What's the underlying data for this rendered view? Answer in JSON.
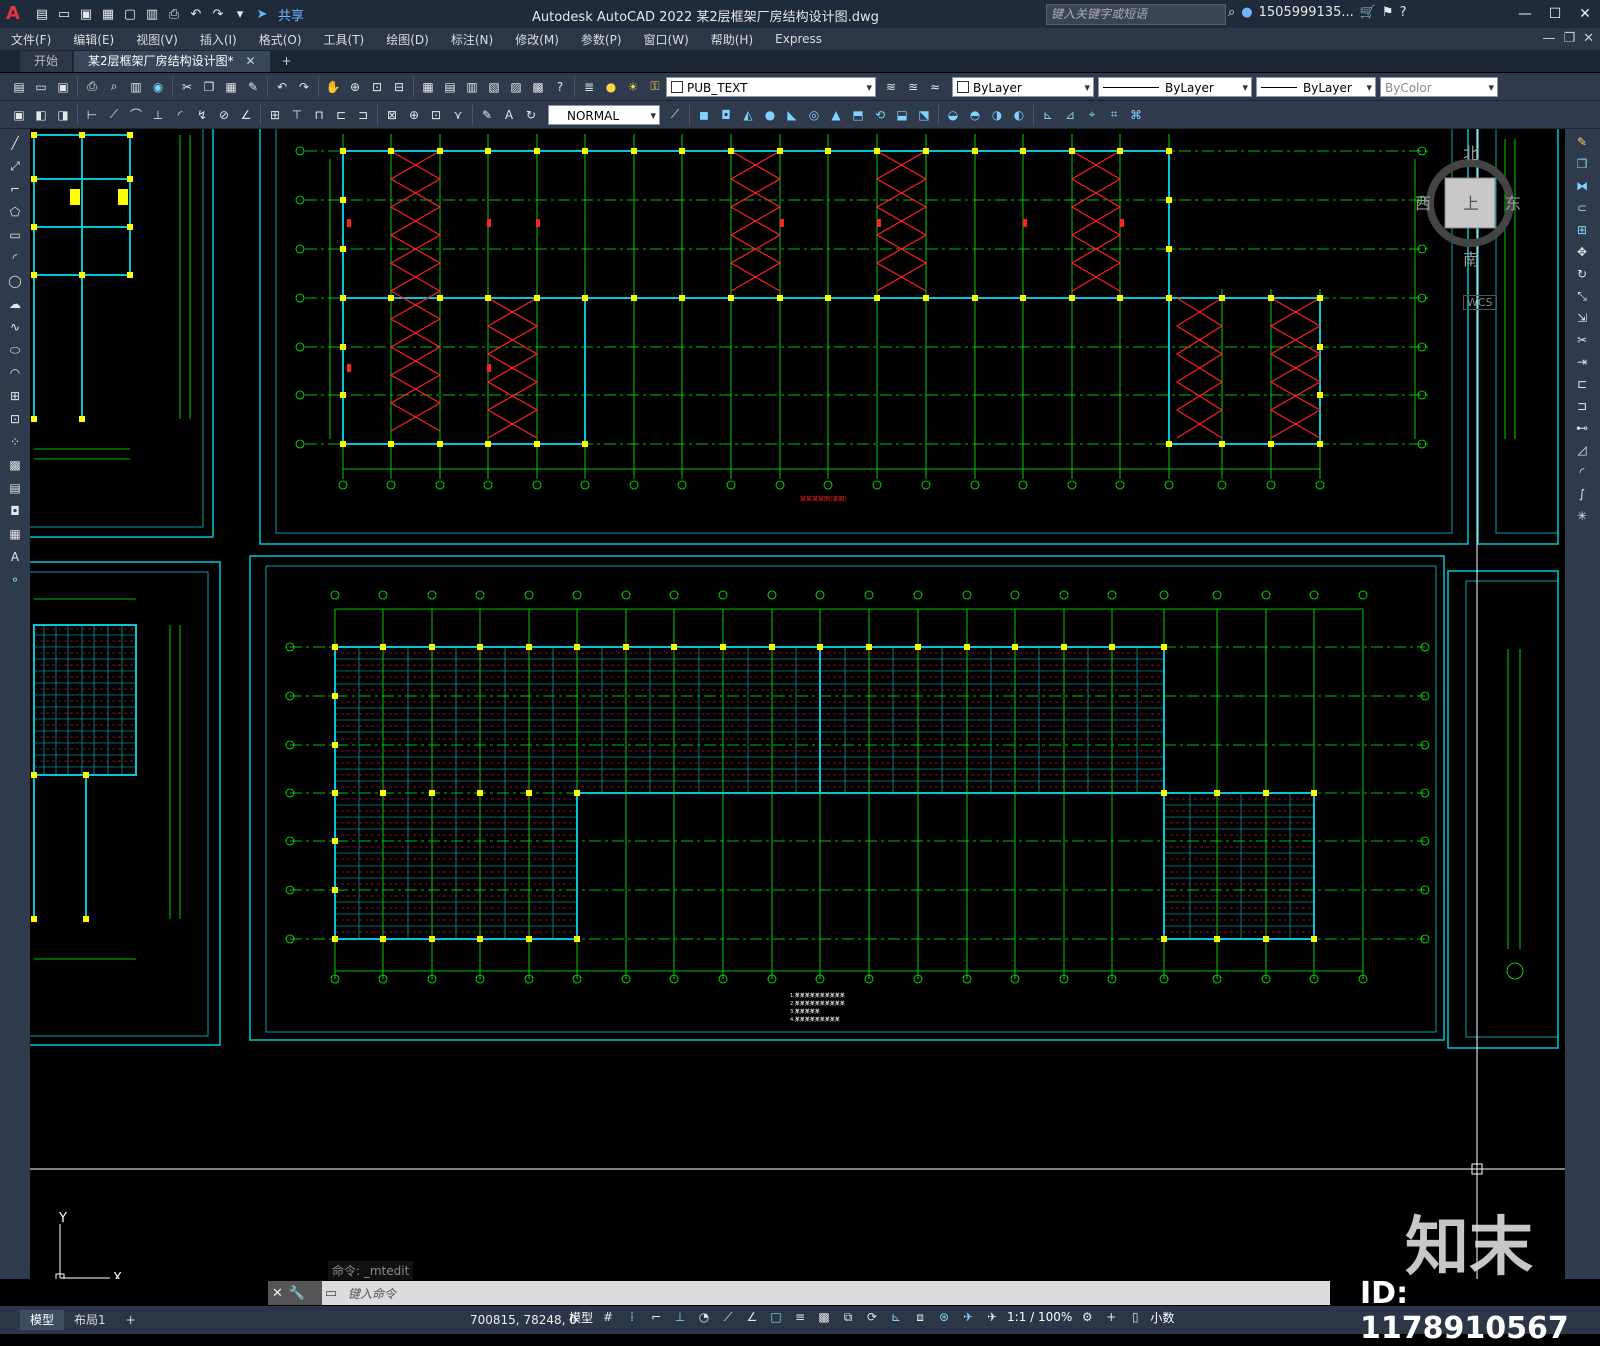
{
  "titlebar": {
    "app_logo": "A",
    "title": "Autodesk AutoCAD 2022    某2层框架厂房结构设计图.dwg",
    "share_label": "共享",
    "search_placeholder": "键入关键字或短语",
    "user": "1505999135...",
    "window_buttons": [
      "—",
      "☐",
      "✕"
    ]
  },
  "menubar": {
    "items": [
      "文件(F)",
      "编辑(E)",
      "视图(V)",
      "插入(I)",
      "格式(O)",
      "工具(T)",
      "绘图(D)",
      "标注(N)",
      "修改(M)",
      "参数(P)",
      "窗口(W)",
      "帮助(H)",
      "Express"
    ]
  },
  "tabs": {
    "start": "开始",
    "active": "某2层框架厂房结构设计图*",
    "close": "✕",
    "add": "+"
  },
  "toolbar": {
    "layer": "PUB_TEXT",
    "color": "ByLayer",
    "linetype": "ByLayer",
    "lineweight": "ByLayer",
    "plotstyle": "ByColor",
    "dimstyle": "NORMAL"
  },
  "viewcube": {
    "north": "北",
    "south": "南",
    "east": "东",
    "west": "西",
    "face": "上",
    "wcs": "WCS"
  },
  "drawing": {
    "top_plan_note": "某某某某图(某图)",
    "bottom_plan_notes": [
      "1.某某某某某某某某某某",
      "2.某某某某某某某某某某",
      "3.某某某某某",
      "4.某某某某某某某某某"
    ]
  },
  "command": {
    "history": "命令: _mtedit",
    "prompt": "键入命令"
  },
  "ucs": {
    "y": "Y",
    "x": "X"
  },
  "statusbar": {
    "tabs": [
      "模型",
      "布局1"
    ],
    "add": "+",
    "coords": "700815, 78248, 0",
    "model": "模型",
    "scale": "1:1 / 100%",
    "units": "小数"
  },
  "watermark": {
    "logo": "知末",
    "id": "ID: 1178910567"
  },
  "colors": {
    "grid_green": "#00ff00",
    "frame_cyan": "#00c8d6",
    "brace_red": "#ff2020",
    "node_yellow": "#ffff00",
    "canvas": "#000000"
  }
}
